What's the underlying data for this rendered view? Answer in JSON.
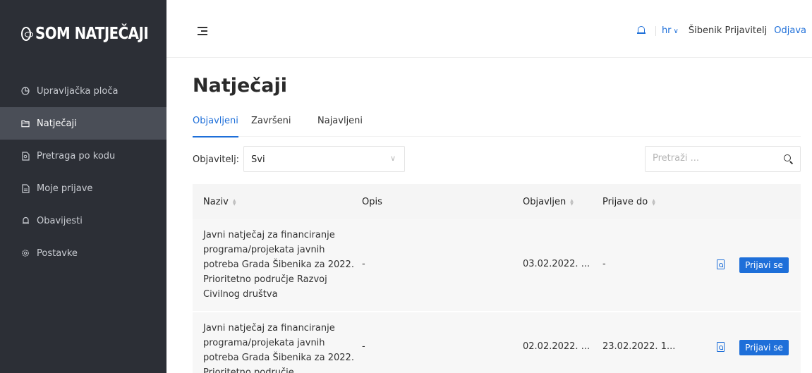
{
  "brand": {
    "logo_text": "SOM NATJEČAJI"
  },
  "sidebar": {
    "items": [
      {
        "label": "Upravljačka ploča",
        "icon": "dashboard-icon"
      },
      {
        "label": "Natječaji",
        "icon": "folder-icon",
        "active": true
      },
      {
        "label": "Pretraga po kodu",
        "icon": "document-search-icon"
      },
      {
        "label": "Moje prijave",
        "icon": "document-icon"
      },
      {
        "label": "Obavijesti",
        "icon": "bell-icon"
      },
      {
        "label": "Postavke",
        "icon": "gear-icon"
      }
    ]
  },
  "header": {
    "language": "hr",
    "user_name": "Šibenik Prijavitelj",
    "logout_label": "Odjava"
  },
  "main": {
    "title": "Natječaji",
    "tabs": [
      {
        "label": "Objavljeni",
        "active": true
      },
      {
        "label": "Završeni"
      },
      {
        "label": "Najavljeni"
      }
    ],
    "filter": {
      "label": "Objavitelj:",
      "value": "Svi"
    },
    "search": {
      "placeholder": "Pretraži ..."
    }
  },
  "table": {
    "columns": [
      "Naziv",
      "Opis",
      "Objavljen",
      "Prijave do"
    ],
    "rows": [
      {
        "name": "Javni natječaj za financiranje programa/projekata javnih potreba Grada Šibenika za 2022. Prioritetno područje Razvoj Civilnog društva",
        "description": "-",
        "published": "03.02.2022. ...",
        "deadline": "-",
        "apply_label": "Prijavi se"
      },
      {
        "name": "Javni natječaj za financiranje programa/projekata javnih potreba Grada Šibenika za 2022. Prioritetno područje",
        "description": "-",
        "published": "02.02.2022. ...",
        "deadline": "23.02.2022. 1...",
        "apply_label": "Prijavi se"
      }
    ]
  },
  "colors": {
    "accent": "#1e6fd9",
    "sidebar_bg": "#2c2f36",
    "sidebar_active": "#4a4e57"
  }
}
